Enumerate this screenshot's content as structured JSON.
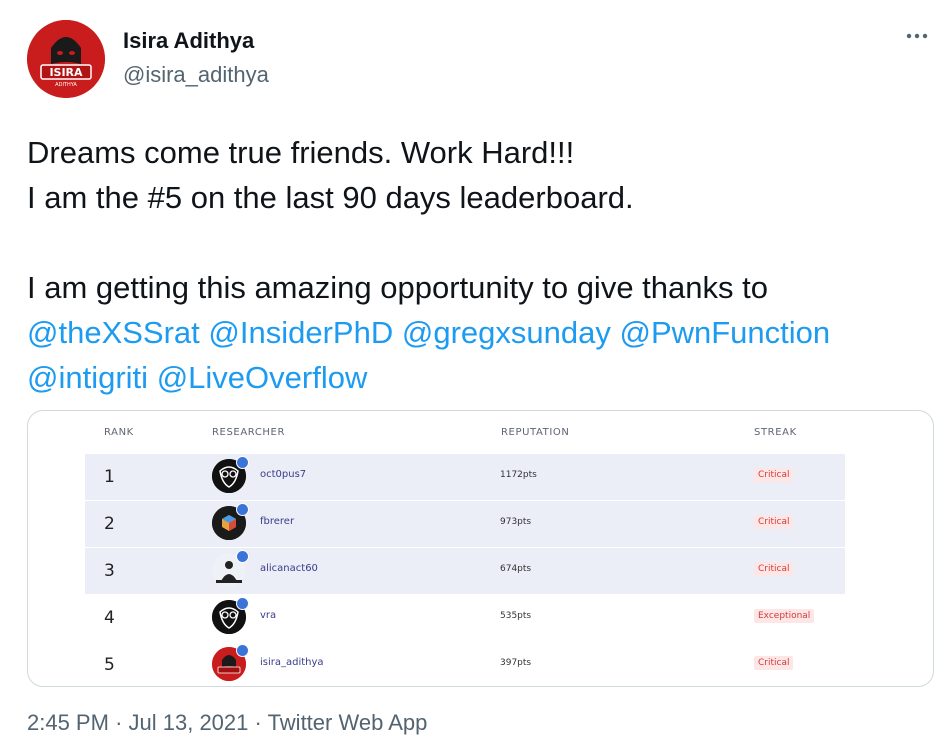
{
  "author": {
    "display_name": "Isira Adithya",
    "handle": "@isira_adithya",
    "avatar_text": "ISIRA",
    "avatar_subtext": "ADITHYA"
  },
  "more_icon": "more-horizontal-icon",
  "tweet": {
    "line1": "Dreams come true friends. Work Hard!!!",
    "line2": "I am the #5 on the last 90 days leaderboard.",
    "line3": "I am getting this amazing opportunity to give thanks to",
    "mentions": [
      "@theXSSrat",
      "@InsiderPhD",
      "@gregxsunday",
      "@PwnFunction",
      "@intigriti",
      "@LiveOverflow"
    ]
  },
  "leaderboard": {
    "headers": {
      "rank": "RANK",
      "researcher": "RESEARCHER",
      "reputation": "REPUTATION",
      "streak": "STREAK"
    },
    "rows": [
      {
        "rank": "1",
        "name": "oct0pus7",
        "reputation": "1172pts",
        "streak": "Critical",
        "avatar": "owl-avatar"
      },
      {
        "rank": "2",
        "name": "fbrerer",
        "reputation": "973pts",
        "streak": "Critical",
        "avatar": "cube-avatar"
      },
      {
        "rank": "3",
        "name": "alicanact60",
        "reputation": "674pts",
        "streak": "Critical",
        "avatar": "silhouette-avatar"
      },
      {
        "rank": "4",
        "name": "vra",
        "reputation": "535pts",
        "streak": "Exceptional",
        "avatar": "owl-avatar"
      },
      {
        "rank": "5",
        "name": "isira_adithya",
        "reputation": "397pts",
        "streak": "Critical",
        "avatar": "red-logo-avatar"
      }
    ]
  },
  "footer": {
    "time": "2:45 PM",
    "sep1": "·",
    "date": "Jul 13, 2021",
    "sep2": "·",
    "app": "Twitter Web App"
  },
  "colors": {
    "mention": "#1d9bf0",
    "text": "#0f1419",
    "secondary": "#536471",
    "avatar_red": "#cc1f1f",
    "streak_red": "#d43a3a",
    "row_shade": "#ebedf7"
  }
}
